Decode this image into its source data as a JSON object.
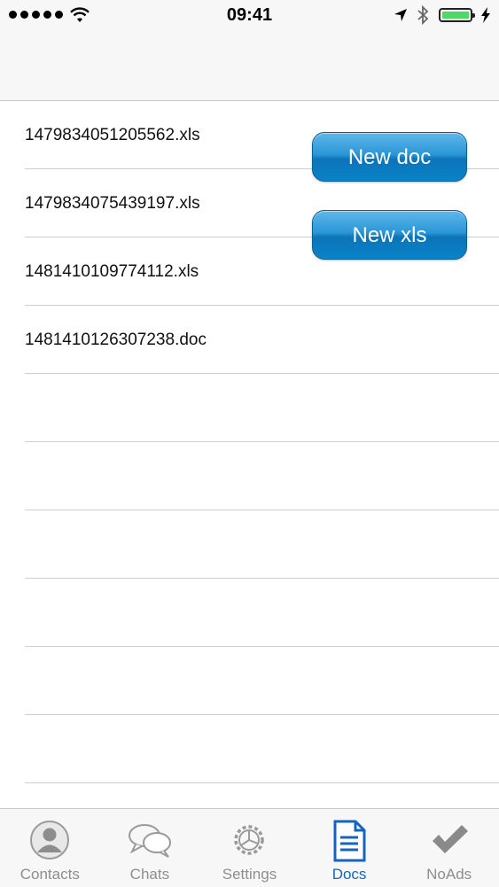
{
  "status": {
    "time": "09:41"
  },
  "documents": [
    {
      "name": "1479834051205562.xls"
    },
    {
      "name": "1479834075439197.xls"
    },
    {
      "name": "1481410109774112.xls"
    },
    {
      "name": "1481410126307238.doc"
    },
    {
      "name": ""
    },
    {
      "name": ""
    },
    {
      "name": ""
    },
    {
      "name": ""
    },
    {
      "name": ""
    },
    {
      "name": ""
    }
  ],
  "actions": {
    "new_doc": "New doc",
    "new_xls": "New xls"
  },
  "tabs": [
    {
      "label": "Contacts",
      "icon": "person-icon"
    },
    {
      "label": "Chats",
      "icon": "chat-bubbles-icon"
    },
    {
      "label": "Settings",
      "icon": "gear-icon"
    },
    {
      "label": "Docs",
      "icon": "document-icon",
      "active": true
    },
    {
      "label": "NoAds",
      "icon": "checkmark-icon"
    }
  ],
  "colors": {
    "accent": "#1565c0",
    "button": "#1a8bd0",
    "battery": "#4cd964"
  }
}
